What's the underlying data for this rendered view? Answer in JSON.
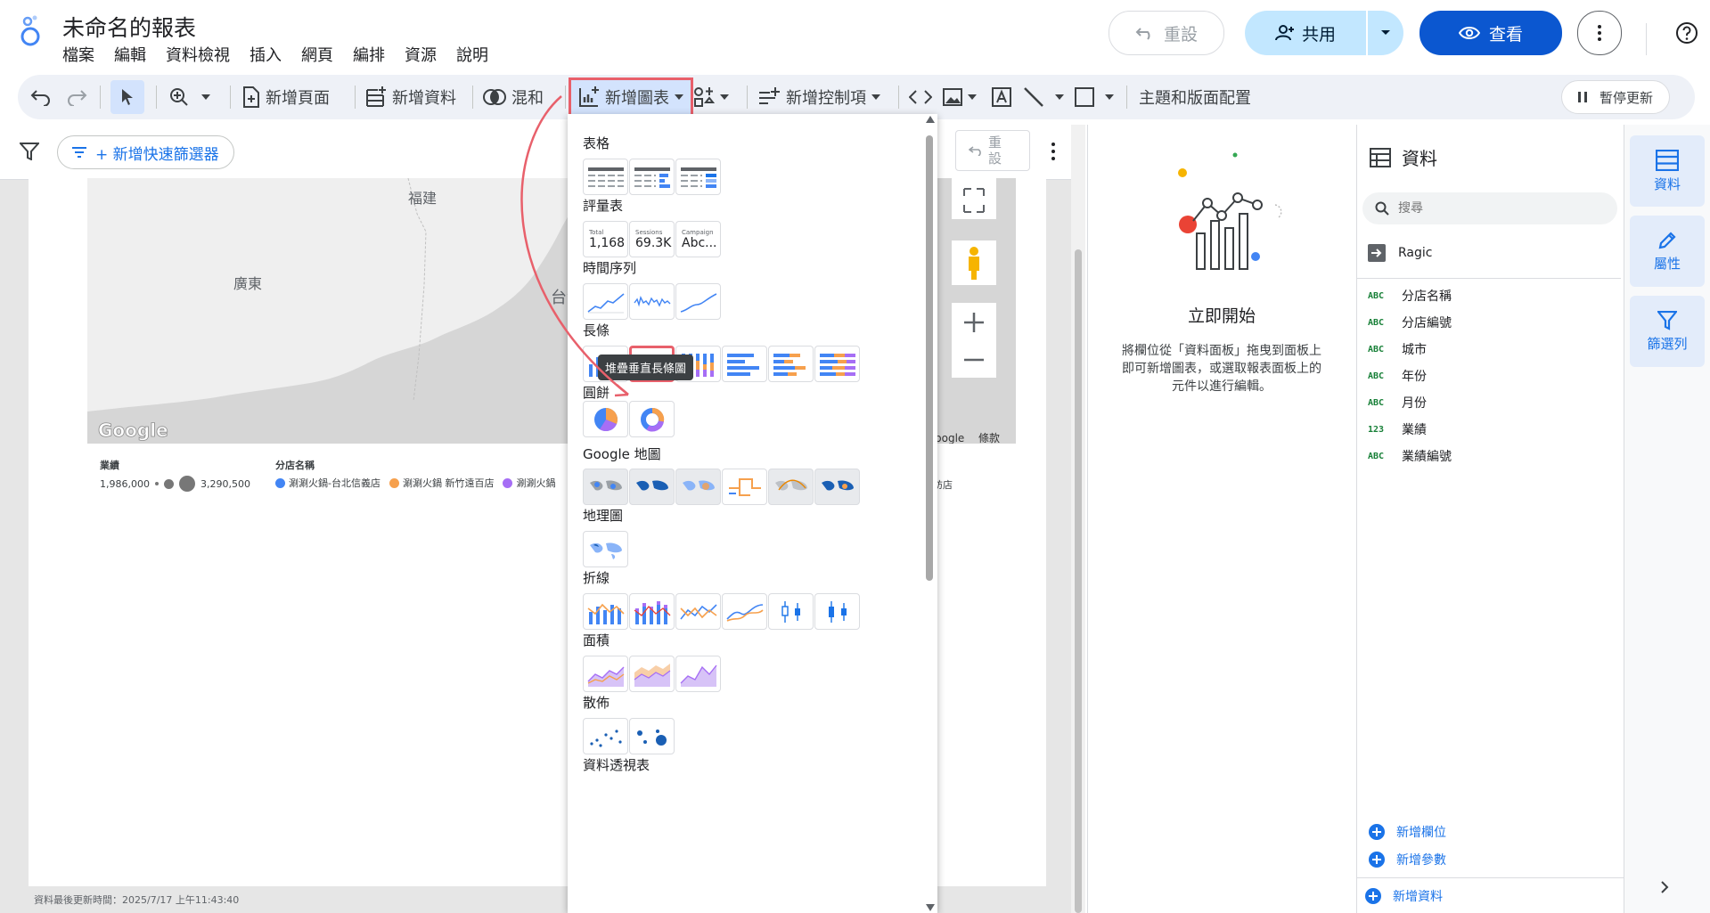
{
  "app": {
    "title": "未命名的報表"
  },
  "menu": [
    "檔案",
    "編輯",
    "資料檢視",
    "插入",
    "網頁",
    "編排",
    "資源",
    "說明"
  ],
  "header_buttons": {
    "reset": "重設",
    "share": "共用",
    "view": "查看"
  },
  "toolbar": {
    "new_page": "新增頁面",
    "add_data": "新增資料",
    "blend": "混和",
    "add_chart": "新增圖表",
    "add_control": "新增控制項",
    "theme_layout": "主題和版面配置",
    "pause_update": "暫停更新"
  },
  "filter_bar": {
    "add_quick_filter": "+ 新增快速篩選器",
    "reset": "重設"
  },
  "map": {
    "labels": [
      "福建",
      "廣東",
      "台灣"
    ],
    "watermark": "Google",
    "footer_left": "Google",
    "footer_right": "條款"
  },
  "legend": {
    "size_title": "業績",
    "size_min": "1,986,000",
    "size_max": "3,290,500",
    "color_title": "分店名稱",
    "color_items": [
      {
        "label": "涮涮火鍋-台北信義店",
        "color": "#4285f4"
      },
      {
        "label": "涮涮火鍋 新竹遠百店",
        "color": "#f6a04d"
      },
      {
        "label": "涮涮火鍋",
        "color": "#a66ef5"
      }
    ],
    "trailing_text": "紡店"
  },
  "dropdown": {
    "sections": {
      "table": "表格",
      "scorecard": "評量表",
      "timeseries": "時間序列",
      "bar": "長條",
      "pie": "圓餅",
      "google_maps": "Google 地圖",
      "geo": "地理圖",
      "line": "折線",
      "area": "面積",
      "scatter": "散佈",
      "pivot": "資料透視表"
    },
    "scorecards": [
      {
        "label": "Total",
        "value": "1,168"
      },
      {
        "label": "Sessions",
        "value": "69.3K"
      },
      {
        "label": "Campaign",
        "value": "Abc..."
      }
    ],
    "tooltip": "堆疊垂直長條圖"
  },
  "setup_panel": {
    "title": "立即開始",
    "description_lines": [
      "將欄位從「資料面板」拖曳到面板上",
      "即可新增圖表，或選取報表面板上的",
      "元件以進行編輯。"
    ]
  },
  "data_panel": {
    "title": "資料",
    "search_placeholder": "搜尋",
    "source": "Ragic",
    "fields": [
      {
        "type": "ABC",
        "name": "分店名稱"
      },
      {
        "type": "ABC",
        "name": "分店編號"
      },
      {
        "type": "ABC",
        "name": "城市"
      },
      {
        "type": "ABC",
        "name": "年份"
      },
      {
        "type": "ABC",
        "name": "月份"
      },
      {
        "type": "123",
        "name": "業績"
      },
      {
        "type": "ABC",
        "name": "業績編號"
      }
    ],
    "add_field": "新增欄位",
    "add_param": "新增參數",
    "add_data": "新增資料"
  },
  "rail": {
    "data": "資料",
    "properties": "屬性",
    "filter": "篩選列"
  },
  "status": {
    "last_updated": "資料最後更新時間：2025/7/17 上午11:43:40"
  },
  "colors": {
    "accent": "#1a73e8",
    "highlight": "#e8606b",
    "share_bg": "#c2e7ff",
    "view_bg": "#0b57d0"
  }
}
